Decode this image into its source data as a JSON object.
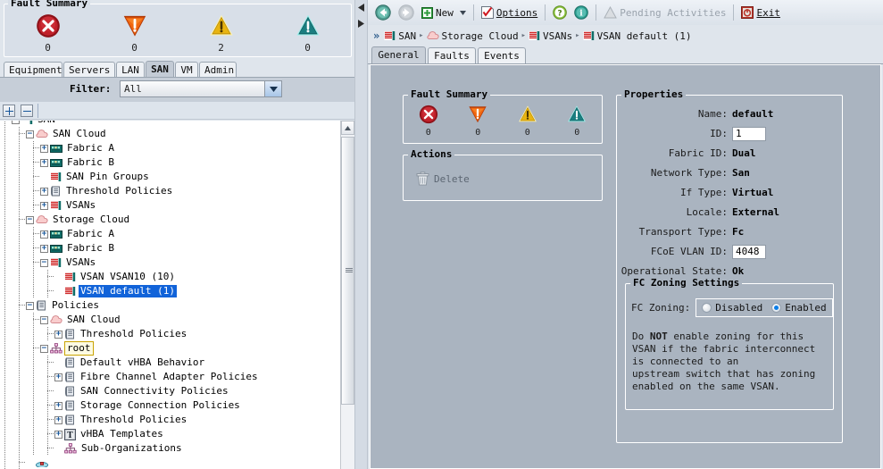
{
  "left": {
    "fault_summary": {
      "title": "Fault Summary",
      "items": [
        {
          "icon": "critical-fault-icon",
          "count": "0"
        },
        {
          "icon": "major-fault-icon",
          "count": "0"
        },
        {
          "icon": "minor-fault-icon",
          "count": "2"
        },
        {
          "icon": "warning-fault-icon",
          "count": "0"
        }
      ]
    },
    "tabs": [
      {
        "label": "Equipment",
        "selected": false
      },
      {
        "label": "Servers",
        "selected": false
      },
      {
        "label": "LAN",
        "selected": false
      },
      {
        "label": "SAN",
        "selected": true
      },
      {
        "label": "VM",
        "selected": false
      },
      {
        "label": "Admin",
        "selected": false
      }
    ],
    "filter": {
      "label": "Filter:",
      "value": "All",
      "arrow_icon": "chevron-down-icon"
    },
    "tree_toolbar": {
      "expand_all": "+",
      "collapse_all": "−"
    },
    "tree": [
      {
        "depth": 0,
        "label": "SAN",
        "icon": "san-node-icon",
        "expander": "-",
        "partial": true
      },
      {
        "depth": 1,
        "label": "SAN Cloud",
        "icon": "cloud-icon",
        "expander": "-"
      },
      {
        "depth": 2,
        "label": "Fabric A",
        "icon": "fabric-icon",
        "expander": "+"
      },
      {
        "depth": 2,
        "label": "Fabric B",
        "icon": "fabric-icon",
        "expander": "+"
      },
      {
        "depth": 2,
        "label": "SAN Pin Groups",
        "icon": "vsan-icon",
        "expander": ""
      },
      {
        "depth": 2,
        "label": "Threshold Policies",
        "icon": "policy-icon",
        "expander": "+"
      },
      {
        "depth": 2,
        "label": "VSANs",
        "icon": "vsan-icon",
        "expander": "+"
      },
      {
        "depth": 1,
        "label": "Storage Cloud",
        "icon": "cloud-icon",
        "expander": "-"
      },
      {
        "depth": 2,
        "label": "Fabric A",
        "icon": "fabric-icon",
        "expander": "+"
      },
      {
        "depth": 2,
        "label": "Fabric B",
        "icon": "fabric-icon",
        "expander": "+"
      },
      {
        "depth": 2,
        "label": "VSANs",
        "icon": "vsan-icon",
        "expander": "-"
      },
      {
        "depth": 3,
        "label": "VSAN VSAN10  (10)",
        "icon": "vsan-icon",
        "expander": ""
      },
      {
        "depth": 3,
        "label": "VSAN default  (1)",
        "icon": "vsan-icon",
        "expander": "",
        "selected": true
      },
      {
        "depth": 1,
        "label": "Policies",
        "icon": "policy-icon",
        "expander": "-"
      },
      {
        "depth": 2,
        "label": "SAN Cloud",
        "icon": "cloud-icon",
        "expander": "-"
      },
      {
        "depth": 3,
        "label": "Threshold Policies",
        "icon": "policy-icon",
        "expander": "+"
      },
      {
        "depth": 2,
        "label": "root",
        "icon": "org-icon",
        "expander": "-",
        "focus": true
      },
      {
        "depth": 3,
        "label": "Default vHBA Behavior",
        "icon": "policy-icon",
        "expander": ""
      },
      {
        "depth": 3,
        "label": "Fibre Channel Adapter Policies",
        "icon": "policy-icon",
        "expander": "+"
      },
      {
        "depth": 3,
        "label": "SAN Connectivity Policies",
        "icon": "policy-icon",
        "expander": ""
      },
      {
        "depth": 3,
        "label": "Storage Connection Policies",
        "icon": "policy-icon",
        "expander": "+"
      },
      {
        "depth": 3,
        "label": "Threshold Policies",
        "icon": "policy-icon",
        "expander": "+"
      },
      {
        "depth": 3,
        "label": "vHBA Templates",
        "icon": "template-icon",
        "expander": "+"
      },
      {
        "depth": 3,
        "label": "Sub-Organizations",
        "icon": "org-icon",
        "expander": ""
      },
      {
        "depth": 1,
        "label": "",
        "icon": "pools-icon",
        "expander": "",
        "partial_bottom": true
      }
    ]
  },
  "toolbar": {
    "back_icon": "back-arrow-icon",
    "forward_icon": "forward-arrow-icon",
    "new_label": "New",
    "new_icon": "new-plus-icon",
    "new_dropdown_icon": "chevron-down-icon",
    "options_label": "Options",
    "options_icon": "options-checkbox-icon",
    "help_icon": "help-question-icon",
    "info_icon": "info-icon",
    "pending_label": "Pending Activities",
    "pending_icon": "pending-triangle-icon",
    "exit_label": "Exit",
    "exit_icon": "exit-power-icon"
  },
  "breadcrumb": {
    "root_icon": "double-chevron-icon",
    "items": [
      {
        "label": "SAN",
        "icon": "vsan-icon"
      },
      {
        "label": "Storage Cloud",
        "icon": "cloud-icon"
      },
      {
        "label": "VSANs",
        "icon": "vsan-icon"
      },
      {
        "label": "VSAN default  (1)",
        "icon": "vsan-icon"
      }
    ]
  },
  "content_tabs": [
    {
      "label": "General",
      "selected": true
    },
    {
      "label": "Faults",
      "selected": false
    },
    {
      "label": "Events",
      "selected": false
    }
  ],
  "content": {
    "fault_summary": {
      "title": "Fault Summary",
      "items": [
        {
          "icon": "critical-fault-icon",
          "count": "0"
        },
        {
          "icon": "major-fault-icon",
          "count": "0"
        },
        {
          "icon": "minor-fault-icon",
          "count": "0"
        },
        {
          "icon": "warning-fault-icon",
          "count": "0"
        }
      ]
    },
    "actions": {
      "title": "Actions",
      "delete_label": "Delete",
      "delete_icon": "trash-icon"
    },
    "properties": {
      "title": "Properties",
      "rows": [
        {
          "label": "Name:",
          "value": "default",
          "type": "text"
        },
        {
          "label": "ID:",
          "value": "1",
          "type": "input",
          "width": 38
        },
        {
          "label": "Fabric ID:",
          "value": "Dual",
          "type": "text"
        },
        {
          "label": "Network Type:",
          "value": "San",
          "type": "text"
        },
        {
          "label": "If Type:",
          "value": "Virtual",
          "type": "text"
        },
        {
          "label": "Locale:",
          "value": "External",
          "type": "text"
        },
        {
          "label": "Transport Type:",
          "value": "Fc",
          "type": "text"
        },
        {
          "label": "FCoE VLAN ID:",
          "value": "4048",
          "type": "input",
          "width": 38
        },
        {
          "label": "Operational State:",
          "value": "Ok",
          "type": "text"
        }
      ]
    },
    "zoning": {
      "title": "FC Zoning Settings",
      "field_label": "FC Zoning:",
      "options": [
        {
          "label": "Disabled",
          "selected": false
        },
        {
          "label": "Enabled",
          "selected": true
        }
      ],
      "note_pre": "Do ",
      "note_bold": "NOT",
      "note_post": " enable zoning for this VSAN if the fabric interconnect is connected to an",
      "note_line2": "upstream switch that has zoning enabled on the same VSAN."
    }
  },
  "colors": {
    "critical": "#c0202a",
    "major": "#f05a12",
    "minor": "#e8b411",
    "warning": "#1b7e80",
    "selection": "#1163d9",
    "content_bg": "#aab4c0",
    "panel_bg": "#dfe5ec",
    "accent": "#0a7de8"
  }
}
